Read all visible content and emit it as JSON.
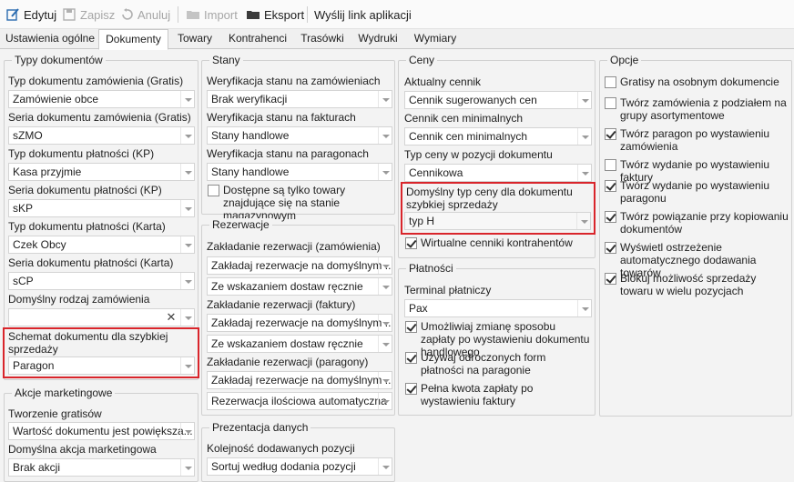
{
  "toolbar": {
    "edit": "Edytuj",
    "save": "Zapisz",
    "cancel": "Anuluj",
    "import": "Import",
    "export": "Eksport",
    "send_link": "Wyślij link aplikacji"
  },
  "tabs": [
    "Ustawienia ogólne",
    "Dokumenty",
    "Towary",
    "Kontrahenci",
    "Trasówki",
    "Wydruki",
    "Wymiary"
  ],
  "doc_types": {
    "title": "Typy dokumentów",
    "order_type_label": "Typ dokumentu zamówienia (Gratis)",
    "order_type_value": "Zamówienie obce",
    "order_series_label": "Seria dokumentu zamówienia (Gratis)",
    "order_series_value": "sZMO",
    "kp_type_label": "Typ dokumentu płatności (KP)",
    "kp_type_value": "Kasa przyjmie",
    "kp_series_label": "Seria dokumentu płatności (KP)",
    "kp_series_value": "sKP",
    "card_type_label": "Typ dokumentu płatności (Karta)",
    "card_type_value": "Czek Obcy",
    "card_series_label": "Seria dokumentu płatności (Karta)",
    "card_series_value": "sCP",
    "default_order_kind_label": "Domyślny rodzaj zamówienia",
    "default_order_kind_value": "",
    "quick_sale_scheme_label": "Schemat dokumentu dla szybkiej sprzedaży",
    "quick_sale_scheme_value": "Paragon"
  },
  "marketing": {
    "title": "Akcje marketingowe",
    "free_creation_label": "Tworzenie gratisów",
    "free_creation_value": "Wartość dokumentu jest powiększa...",
    "default_action_label": "Domyślna akcja marketingowa",
    "default_action_value": "Brak akcji"
  },
  "stock": {
    "title": "Stany",
    "orders_label": "Weryfikacja stanu na zamówieniach",
    "orders_value": "Brak weryfikacji",
    "invoices_label": "Weryfikacja stanu na fakturach",
    "invoices_value": "Stany handlowe",
    "receipts_label": "Weryfikacja stanu na paragonach",
    "receipts_value": "Stany handlowe",
    "available_only_label": "Dostępne są tylko towary znajdujące się na stanie magazynowym"
  },
  "reservations": {
    "title": "Rezerwacje",
    "orders_label": "Zakładanie rezerwacji (zamówienia)",
    "orders_value1": "Zakładaj rezerwacje na domyślnym ...",
    "orders_value2": "Ze wskazaniem dostaw ręcznie",
    "invoices_label": "Zakładanie rezerwacji (faktury)",
    "invoices_value1": "Zakładaj rezerwacje na domyślnym ...",
    "invoices_value2": "Ze wskazaniem dostaw ręcznie",
    "receipts_label": "Zakładanie rezerwacji (paragony)",
    "receipts_value1": "Zakładaj rezerwacje na domyślnym ...",
    "receipts_value2": "Rezerwacja ilościowa automatyczna"
  },
  "presentation": {
    "title": "Prezentacja danych",
    "order_label": "Kolejność dodawanych pozycji",
    "order_value": "Sortuj według dodania pozycji"
  },
  "prices": {
    "title": "Ceny",
    "current_label": "Aktualny cennik",
    "current_value": "Cennik sugerowanych cen",
    "minimal_label": "Cennik cen minimalnych",
    "minimal_value": "Cennik cen minimalnych",
    "position_type_label": "Typ ceny w pozycji dokumentu",
    "position_type_value": "Cennikowa",
    "quick_sale_label": "Domyślny typ ceny dla dokumentu szybkiej sprzedaży",
    "quick_sale_value": "typ H",
    "virtual_label": "Wirtualne cenniki kontrahentów"
  },
  "payments": {
    "title": "Płatności",
    "terminal_label": "Terminal płatniczy",
    "terminal_value": "Pax",
    "opt1": "Umożliwiaj zmianę sposobu zapłaty po wystawieniu dokumentu handlowego",
    "opt2": "Używaj odroczonych form płatności na paragonie",
    "opt3": "Pełna kwota zapłaty po wystawieniu faktury"
  },
  "options": {
    "title": "Opcje",
    "o1": "Gratisy na osobnym dokumencie",
    "o2": "Twórz zamówienia z podziałem na grupy asortymentowe",
    "o3": "Twórz paragon po wystawieniu zamówienia",
    "o4": "Twórz wydanie po wystawieniu faktury",
    "o5": "Twórz wydanie po wystawieniu paragonu",
    "o6": "Twórz powiązanie przy kopiowaniu dokumentów",
    "o7": "Wyświetl ostrzeżenie automatycznego dodawania towarów",
    "o8": "Blokuj możliwość sprzedaży towaru w wielu pozycjach"
  }
}
